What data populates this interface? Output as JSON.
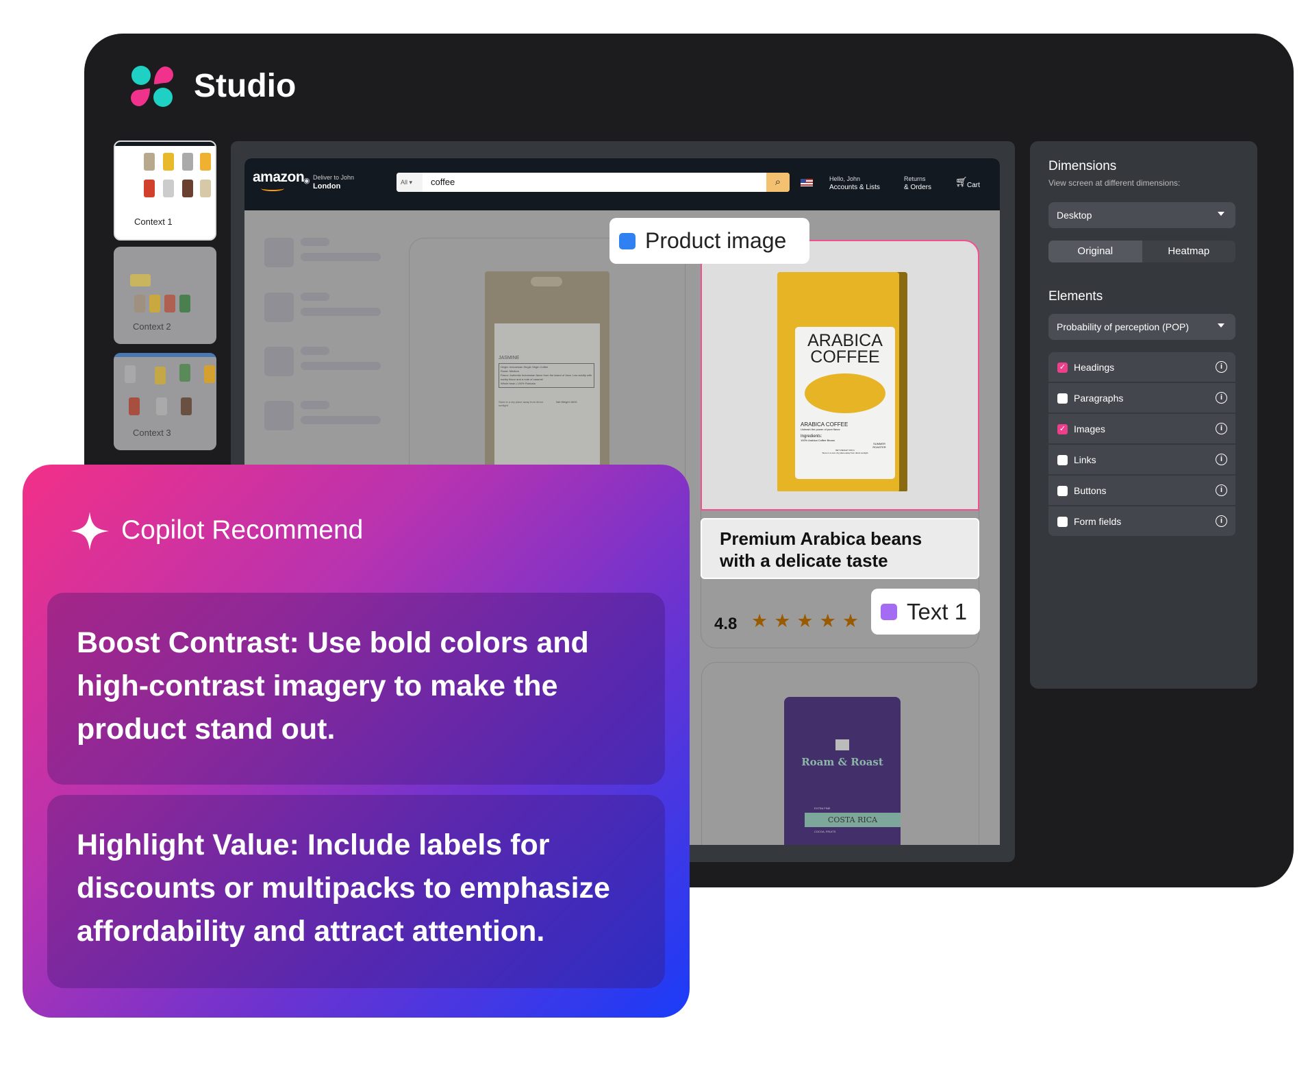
{
  "app": {
    "title": "Studio",
    "logo_colors": [
      "#1fd1c4",
      "#f0328c"
    ]
  },
  "thumbnails": [
    {
      "label": "Context 1",
      "active": true
    },
    {
      "label": "Context 2",
      "active": false
    },
    {
      "label": "Context 3",
      "active": false
    }
  ],
  "amazon": {
    "logo": "amazon",
    "deliver_line1": "Deliver to John",
    "deliver_line2": "London",
    "search_category": "All",
    "search_value": "coffee",
    "account_line1": "Hello, John",
    "account_line2": "Accounts & Lists",
    "returns_line1": "Returns",
    "returns_line2": "& Orders",
    "cart": "Cart"
  },
  "overlay": {
    "product_image_tag": "Product image",
    "product_image_color": "#2f80f0",
    "text_tag": "Text 1",
    "text_tag_color": "#a46cf2",
    "product_title": "Premium Arabica beans with a delicate taste",
    "rating": "4.8",
    "stars": 5,
    "highlight_color": "#f0508f"
  },
  "products": {
    "jasmine": {
      "name": "JASMINE",
      "origin_label": "Origin",
      "origin": "Indonesian Single Origin Coffee",
      "roast_label": "Roast",
      "roast": "Medium",
      "flavor_label": "Flavor",
      "flavor": "Authentic Indonesian flavor from the island of Java. Low acidity with earthy flavor and a note of caramel",
      "type": "Whole bean",
      "blend": "100% Robusta",
      "storage": "Store in a dry place away from direct sunlight",
      "weight": "Net Weight 150G"
    },
    "arabica": {
      "title_line1": "ARABICA",
      "title_line2": "COFFEE",
      "subtitle": "ARABICA COFFEE",
      "tagline": "Unleash the power of pure flavor",
      "ingredients_label": "Ingredients:",
      "ingredients": "100% Arabica Coffee Beans",
      "brand": "SUMMER ROASTER",
      "weight": "NET WEIGHT 150 G",
      "storage": "Store in a cool, dry place away from direct sunlight"
    },
    "roast": {
      "brand": "Roam & Roast",
      "grade": "EXTRA FINE",
      "origin": "COSTA RICA",
      "notes": "COCOA, FRUITS"
    }
  },
  "right_panel": {
    "dimensions_title": "Dimensions",
    "dimensions_sub": "View screen at different dimensions:",
    "device": "Desktop",
    "view_tabs": [
      {
        "label": "Original",
        "active": true
      },
      {
        "label": "Heatmap",
        "active": false
      }
    ],
    "elements_title": "Elements",
    "metric": "Probability of perception (POP)",
    "elements": [
      {
        "label": "Headings",
        "checked": true
      },
      {
        "label": "Paragraphs",
        "checked": false
      },
      {
        "label": "Images",
        "checked": true
      },
      {
        "label": "Links",
        "checked": false
      },
      {
        "label": "Buttons",
        "checked": false
      },
      {
        "label": "Form fields",
        "checked": false
      }
    ],
    "check_color": "#ec3f8c"
  },
  "copilot": {
    "title": "Copilot Recommend",
    "recommendations": [
      "Boost Contrast: Use bold colors and high-contrast imagery to make the product stand out.",
      "Highlight Value: Include labels for discounts or multipacks to emphasize affordability and attract attention."
    ]
  }
}
